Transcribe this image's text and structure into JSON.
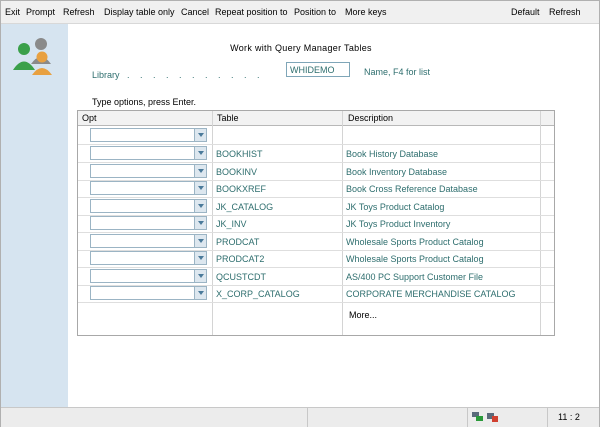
{
  "menubar": {
    "exit": "Exit",
    "prompt": "Prompt",
    "refresh": "Refresh",
    "display_table_only": "Display table only",
    "cancel": "Cancel",
    "repeat_position_to": "Repeat position to",
    "position_to": "Position to",
    "more_keys": "More keys",
    "default": "Default",
    "refresh_right": "Refresh"
  },
  "header": {
    "title": "Work with Query Manager Tables",
    "library_label": "Library",
    "library_dots": ". . . . . . . . . . .",
    "library_value": "WHIDEMO",
    "library_hint": "Name,  F4  for  list",
    "options_label": "Type options, press Enter."
  },
  "table": {
    "columns": [
      "Opt",
      "Table",
      "Description"
    ],
    "rows": [
      {
        "table": "BOOKHIST",
        "description": "Book History Database"
      },
      {
        "table": "BOOKINV",
        "description": "Book Inventory Database"
      },
      {
        "table": "BOOKXREF",
        "description": "Book Cross Reference Database"
      },
      {
        "table": "JK_CATALOG",
        "description": "JK Toys Product Catalog"
      },
      {
        "table": "JK_INV",
        "description": "JK Toys Product Inventory"
      },
      {
        "table": "PRODCAT",
        "description": "Wholesale Sports Product Catalog"
      },
      {
        "table": "PRODCAT2",
        "description": "Wholesale Sports Product Catalog"
      },
      {
        "table": "QCUSTCDT",
        "description": "AS/400 PC Support Customer File"
      },
      {
        "table": "X_CORP_CATALOG",
        "description": "CORPORATE MERCHANDISE CATALOG"
      }
    ],
    "more": "More..."
  },
  "status": {
    "cursor_position": "11 : 2"
  },
  "icons": {
    "avatar": "users-group-icon",
    "status_left": "network-icon",
    "status_right": "keyboard-lock-icon"
  }
}
